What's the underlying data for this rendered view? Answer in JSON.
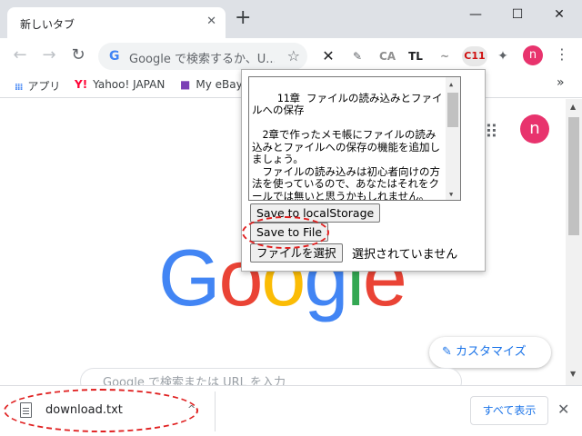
{
  "browser": {
    "tab_title": "新しいタブ",
    "tab_close": "✕",
    "new_tab": "+",
    "minimize": "—",
    "maximize": "☐",
    "close": "✕"
  },
  "toolbar": {
    "back": "←",
    "forward": "→",
    "reload": "↻",
    "omnibox_g": "G",
    "omnibox_placeholder": "Google で検索するか、U...",
    "star": "☆",
    "extensions": [
      "✕",
      "✎",
      "CA",
      "TL",
      "~",
      "C11",
      "✦"
    ],
    "profile_initial": "n",
    "menu": "⋮"
  },
  "bookmarks": {
    "apps_label": "アプリ",
    "yahoo_label": "Yahoo! JAPAN",
    "ebay_label": "My eBay",
    "overflow": "»"
  },
  "page": {
    "google_letters": [
      "G",
      "o",
      "o",
      "g",
      "l",
      "e"
    ],
    "google_colors": [
      "#4285f4",
      "#ea4335",
      "#fbbc05",
      "#4285f4",
      "#34a853",
      "#ea4335"
    ],
    "apps_icon": "⋮⋮⋮",
    "profile_initial": "n",
    "customize_label": "カスタマイズ",
    "customize_icon": "✎",
    "search_placeholder": "Google で検索または URL を入力"
  },
  "popup": {
    "textarea_content": "11章 ファイルの読み込みとファイルへの保存\n\n　2章で作ったメモ帳にファイルの読み込みとファイルへの保存の機能を追加しましょう。\n　ファイルの読み込みは初心者向けの方法を使っているので、あなたはそれをクールでは無いと思うかもしれません。JavaScriptの高度な機能を使ってファイルを読み込む方法もあります。",
    "save_local_label": "Save to localStorage",
    "save_file_label": "Save to File",
    "choose_file_label": "ファイルを選択",
    "no_file_label": "選択されていません"
  },
  "downloads": {
    "file_name": "download.txt",
    "chevron": "^",
    "show_all_label": "すべて表示",
    "close": "✕"
  },
  "highlight_color": "#e02020"
}
